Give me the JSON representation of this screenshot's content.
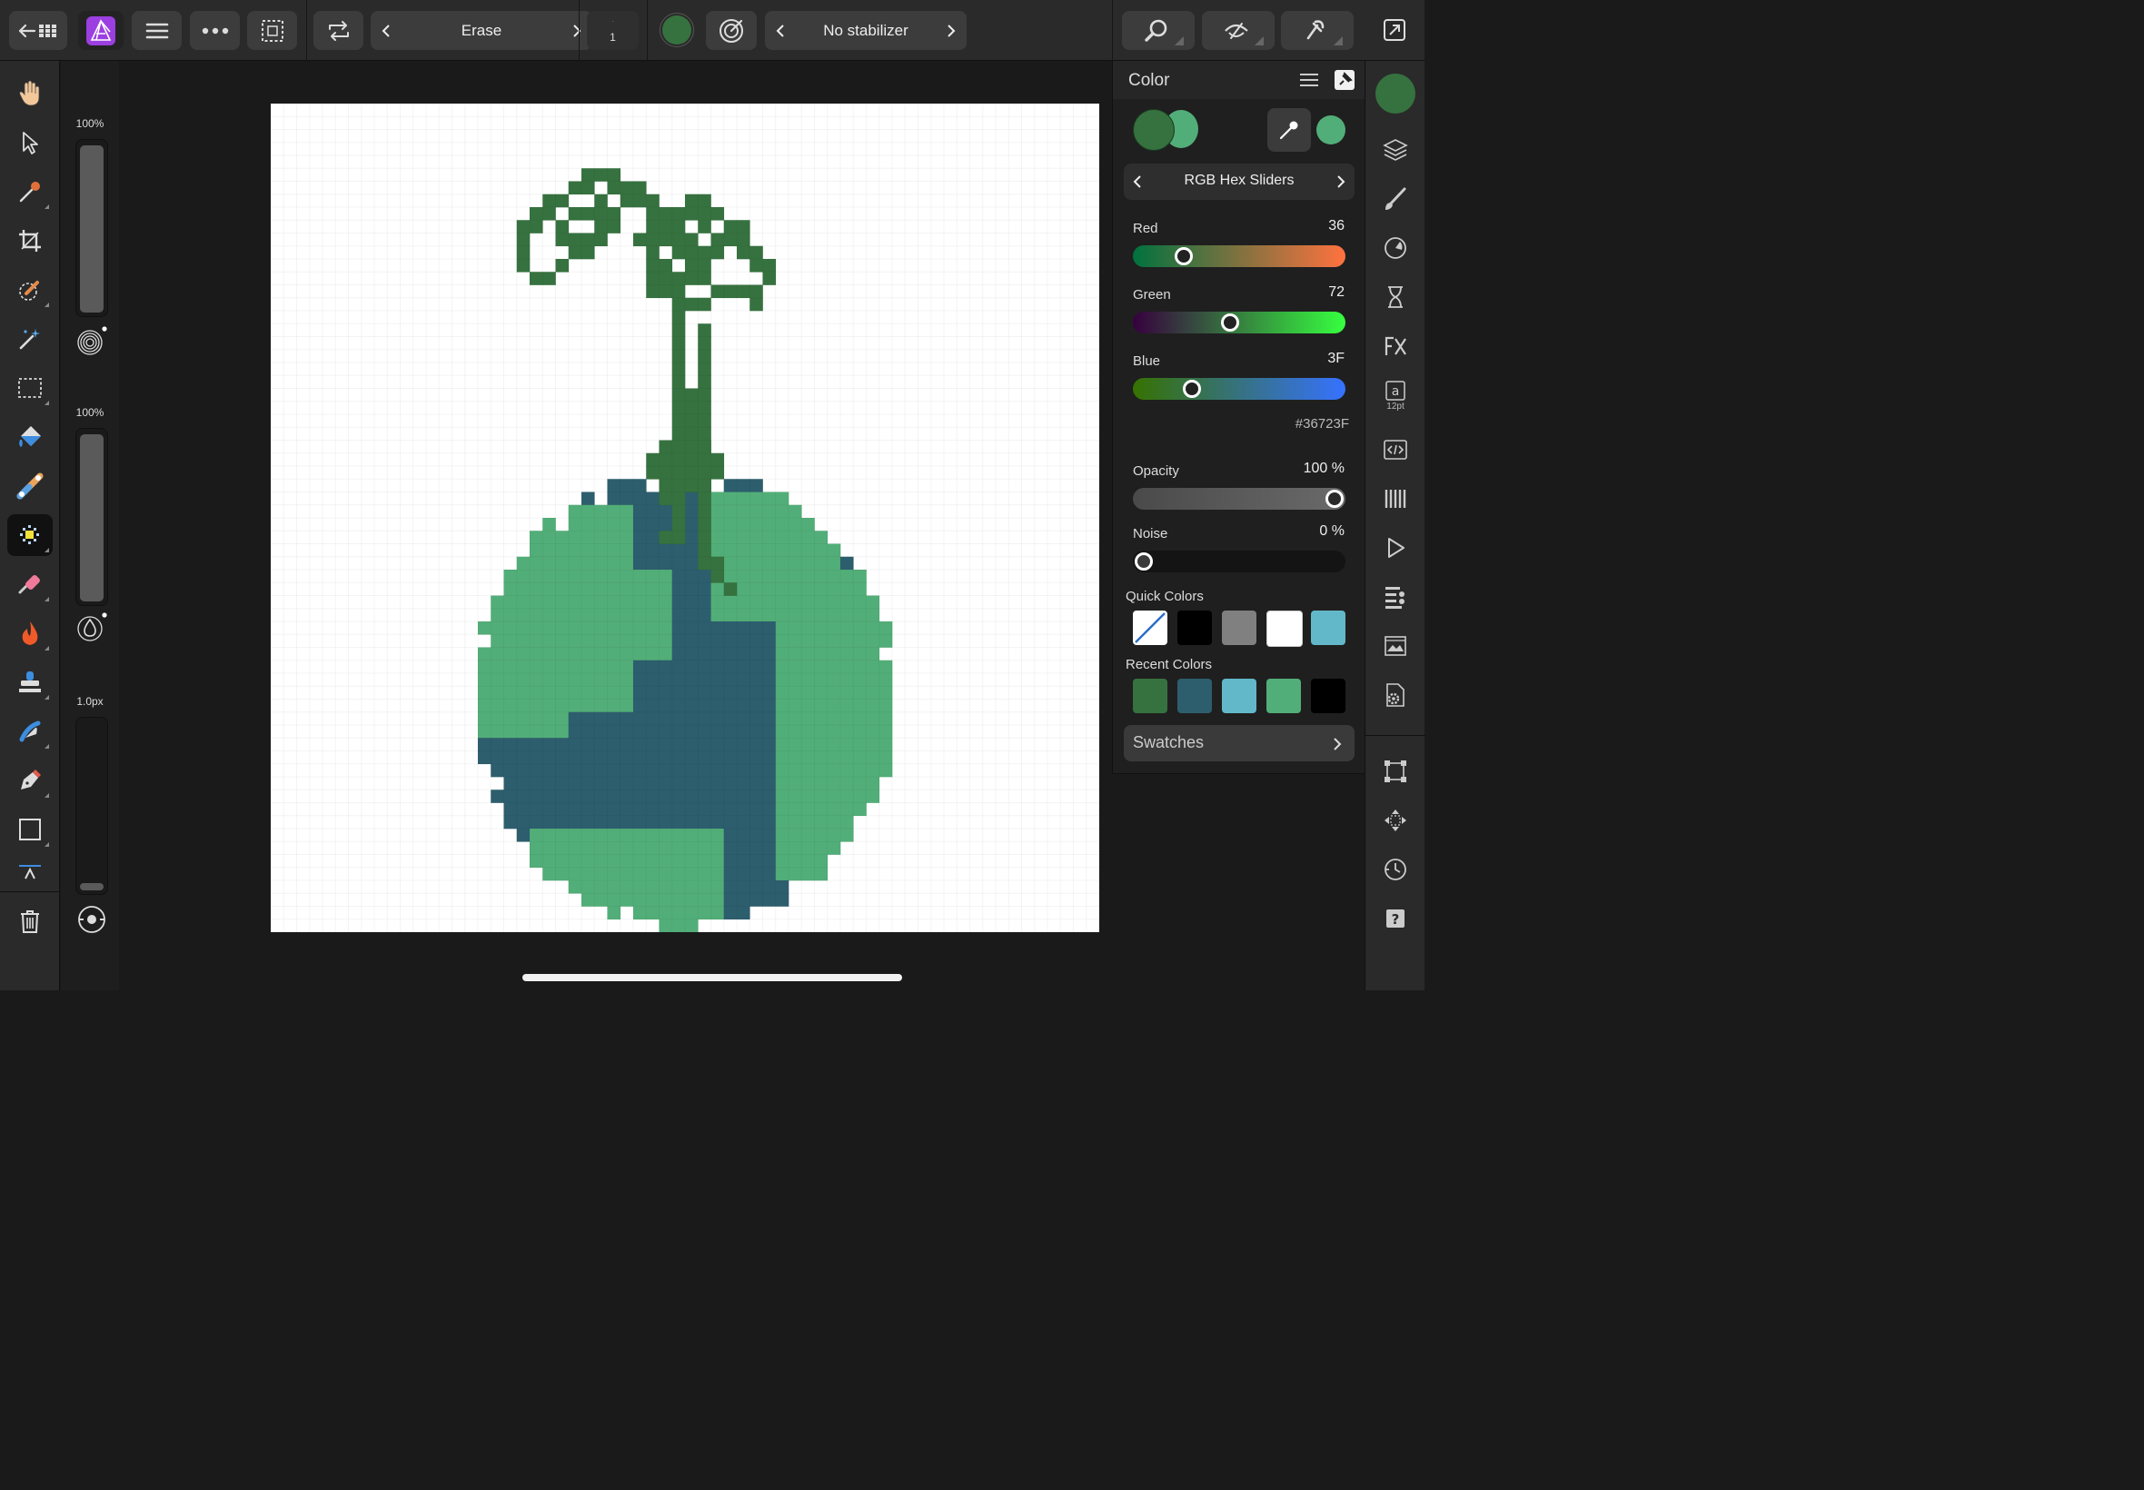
{
  "toolbar": {
    "tool_name": "Erase",
    "stepper_value": "1",
    "stabilizer": "No stabilizer",
    "current_color": "#36723F"
  },
  "context": {
    "size_pct": "100%",
    "opacity_pct": "100%",
    "width_px": "1.0px",
    "size_level": 1.0,
    "opacity_level": 1.0,
    "width_level": 0.0
  },
  "color_panel": {
    "title": "Color",
    "mode": "RGB Hex Sliders",
    "primary_color": "#36723F",
    "secondary_color": "#52AE78",
    "sliders": {
      "red": {
        "label": "Red",
        "value": "36",
        "level": 0.21
      },
      "green": {
        "label": "Green",
        "value": "72",
        "level": 0.45
      },
      "blue": {
        "label": "Blue",
        "value": "3F",
        "level": 0.25
      }
    },
    "hex": "#36723F",
    "opacity": {
      "label": "Opacity",
      "value": "100 %",
      "level": 1.0
    },
    "noise": {
      "label": "Noise",
      "value": "0 %",
      "level": 0.0
    },
    "quick_colors_label": "Quick Colors",
    "quick_colors": [
      "none",
      "#000000",
      "#808080",
      "#FFFFFF",
      "#62B8C8"
    ],
    "recent_colors_label": "Recent Colors",
    "recent_colors": [
      "#36723F",
      "#2D5E6E",
      "#62B8C8",
      "#52AE78",
      "#000000"
    ],
    "swatches_label": "Swatches"
  },
  "studio": {
    "text_size": "12pt"
  },
  "artwork": {
    "colors": {
      "stem": "#36723F",
      "ocean": "#2D5E6E",
      "land": "#52AE78"
    }
  }
}
